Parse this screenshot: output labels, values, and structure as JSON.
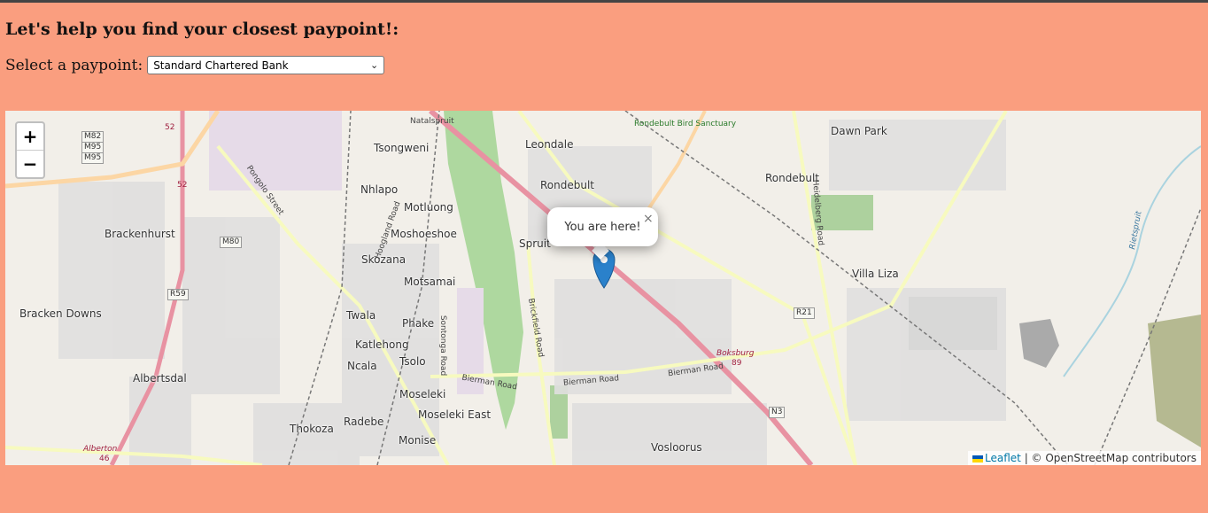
{
  "page": {
    "heading": "Let's help you find your closest paypoint!:",
    "select_label": "Select a paypoint:",
    "select_value": "Standard Chartered Bank"
  },
  "map": {
    "zoom_in": "+",
    "zoom_out": "−",
    "popup_text": "You are here!",
    "popup_close": "×",
    "attribution_link": "Leaflet",
    "attribution_text": " | © OpenStreetMap contributors",
    "places": [
      "Tsongweni",
      "Leondale",
      "Dawn Park",
      "Rondebult",
      "Rondebult",
      "Nhlapo",
      "Motluong",
      "Moshoeshoe",
      "Brackenhurst",
      "Spruit",
      "Villa Liza",
      "Skozana",
      "Motsamai",
      "Bracken Downs",
      "Twala",
      "Phake",
      "Katlehong",
      "Ncala",
      "Tsolo",
      "Albertsdal",
      "Moseleki",
      "Moseleki East",
      "Radebe",
      "Thokoza",
      "Monise",
      "Vosloorus"
    ],
    "roads": [
      "Natalspruit",
      "Rondebult Bird Sanctuary",
      "Pongolo Street",
      "Hoogland Road",
      "Heidelberg Road",
      "Brickfield Road",
      "Bierman Road",
      "Bierman Road",
      "Bierman Road",
      "Sontonga Road",
      "Boksburg",
      "Rietspruit",
      "Alberton"
    ],
    "shields": [
      "M82",
      "M95",
      "M95",
      "52",
      "52",
      "M80",
      "R59",
      "R21",
      "N3",
      "89",
      "46"
    ]
  }
}
